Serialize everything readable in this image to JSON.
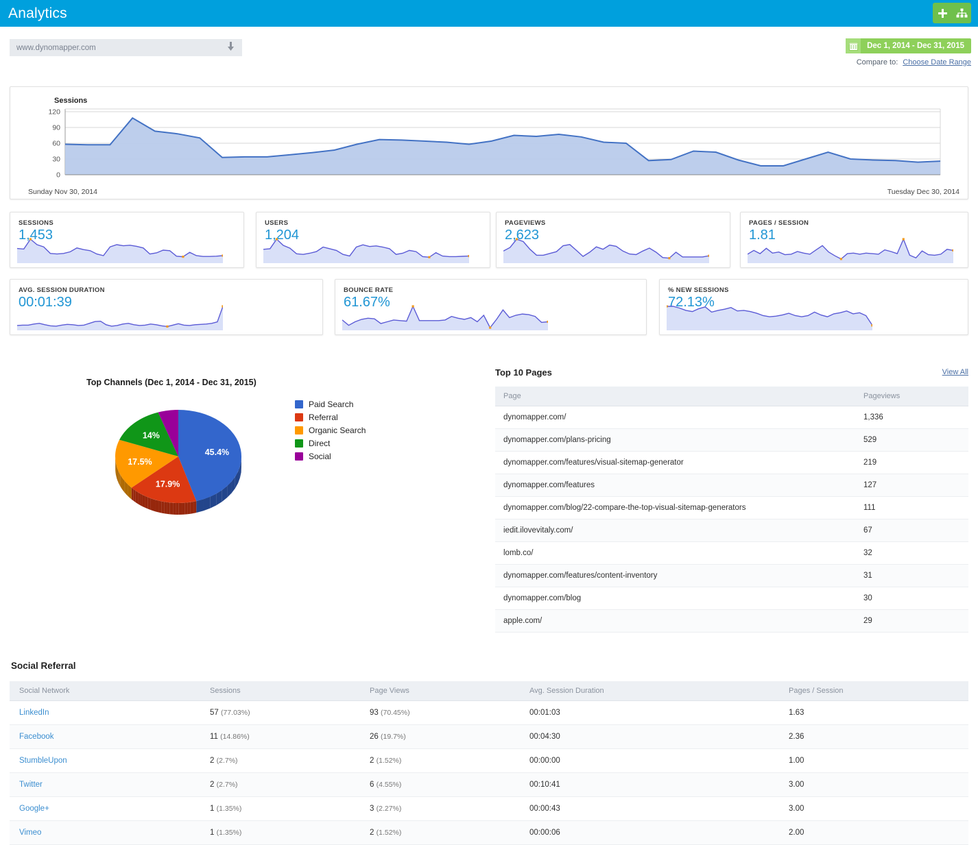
{
  "app": {
    "title": "Analytics",
    "brand_blue": "#00a0dd",
    "brand_green": "#6fc04c",
    "accent_blue": "#2196d4",
    "add_icon": "plus-icon",
    "sitemap_icon": "sitemap-icon"
  },
  "filters": {
    "site_value": "www.dynomapper.com",
    "site_caret_icon": "arrow-down-icon",
    "calendar_icon": "calendar-icon",
    "date_range": "Dec 1, 2014 - Dec 31, 2015",
    "compare_label": "Compare to:",
    "compare_link": "Choose Date Range"
  },
  "sessions_chart": {
    "title": "Sessions",
    "start_date": "Sunday Nov 30, 2014",
    "end_date": "Tuesday Dec 30, 2014"
  },
  "kpis": [
    {
      "label": "SESSIONS",
      "value": "1,453"
    },
    {
      "label": "USERS",
      "value": "1,204"
    },
    {
      "label": "PAGEVIEWS",
      "value": "2,623"
    },
    {
      "label": "PAGES / SESSION",
      "value": "1.81"
    },
    {
      "label": "AVG. SESSION DURATION",
      "value": "00:01:39"
    },
    {
      "label": "BOUNCE RATE",
      "value": "61.67%"
    },
    {
      "label": "% NEW SESSIONS",
      "value": "72.13%"
    }
  ],
  "pie": {
    "title": "Top Channels (Dec 1, 2014 - Dec 31, 2015)"
  },
  "top_pages": {
    "title": "Top 10 Pages",
    "view_all": "View All",
    "columns": [
      "Page",
      "Pageviews"
    ],
    "rows": [
      {
        "page": "dynomapper.com/",
        "pageviews": "1,336"
      },
      {
        "page": "dynomapper.com/plans-pricing",
        "pageviews": "529"
      },
      {
        "page": "dynomapper.com/features/visual-sitemap-generator",
        "pageviews": "219"
      },
      {
        "page": "dynomapper.com/features",
        "pageviews": "127"
      },
      {
        "page": "dynomapper.com/blog/22-compare-the-top-visual-sitemap-generators",
        "pageviews": "111"
      },
      {
        "page": "iedit.ilovevitaly.com/",
        "pageviews": "67"
      },
      {
        "page": "lomb.co/",
        "pageviews": "32"
      },
      {
        "page": "dynomapper.com/features/content-inventory",
        "pageviews": "31"
      },
      {
        "page": "dynomapper.com/blog",
        "pageviews": "30"
      },
      {
        "page": "apple.com/",
        "pageviews": "29"
      }
    ]
  },
  "social_referral": {
    "title": "Social Referral",
    "columns": [
      "Social Network",
      "Sessions",
      "Page Views",
      "Avg. Session Duration",
      "Pages / Session"
    ],
    "rows": [
      {
        "network": "LinkedIn",
        "sessions": "57",
        "sessions_pct": "(77.03%)",
        "pageviews": "93",
        "pageviews_pct": "(70.45%)",
        "duration": "00:01:03",
        "pages_session": "1.63"
      },
      {
        "network": "Facebook",
        "sessions": "11",
        "sessions_pct": "(14.86%)",
        "pageviews": "26",
        "pageviews_pct": "(19.7%)",
        "duration": "00:04:30",
        "pages_session": "2.36"
      },
      {
        "network": "StumbleUpon",
        "sessions": "2",
        "sessions_pct": "(2.7%)",
        "pageviews": "2",
        "pageviews_pct": "(1.52%)",
        "duration": "00:00:00",
        "pages_session": "1.00"
      },
      {
        "network": "Twitter",
        "sessions": "2",
        "sessions_pct": "(2.7%)",
        "pageviews": "6",
        "pageviews_pct": "(4.55%)",
        "duration": "00:10:41",
        "pages_session": "3.00"
      },
      {
        "network": "Google+",
        "sessions": "1",
        "sessions_pct": "(1.35%)",
        "pageviews": "3",
        "pageviews_pct": "(2.27%)",
        "duration": "00:00:43",
        "pages_session": "3.00"
      },
      {
        "network": "Vimeo",
        "sessions": "1",
        "sessions_pct": "(1.35%)",
        "pageviews": "2",
        "pageviews_pct": "(1.52%)",
        "duration": "00:00:06",
        "pages_session": "2.00"
      }
    ]
  },
  "chart_data": [
    {
      "type": "area",
      "name": "sessions-main",
      "title": "Sessions",
      "xlabel": "",
      "ylabel": "",
      "ylim": [
        0,
        120
      ],
      "yticks": [
        0,
        30,
        60,
        90,
        120
      ],
      "grid": true,
      "legend": "none",
      "x_start_label": "Sunday Nov 30, 2014",
      "x_end_label": "Tuesday Dec 30, 2014",
      "line_color": "#4372c4",
      "fill_color": "#b9cbeb",
      "values": [
        58,
        57,
        57,
        108,
        83,
        78,
        70,
        33,
        34,
        34,
        38,
        42,
        47,
        58,
        67,
        66,
        64,
        62,
        58,
        64,
        75,
        73,
        77,
        72,
        62,
        60,
        27,
        29,
        45,
        43,
        28,
        17,
        17,
        30,
        43,
        30,
        28,
        27,
        24,
        26
      ]
    },
    {
      "type": "area",
      "name": "sparkline-sessions",
      "title": "SESSIONS",
      "value": "1,453",
      "line_color": "#5b5bd6",
      "fill_color": "#ccd6f5",
      "marker_color": "#f29c1f",
      "values": [
        46,
        44,
        80,
        60,
        52,
        28,
        26,
        28,
        34,
        48,
        42,
        38,
        26,
        20,
        52,
        60,
        56,
        58,
        54,
        48,
        26,
        30,
        40,
        38,
        18,
        16,
        32,
        20,
        17,
        17,
        18,
        20
      ]
    },
    {
      "type": "area",
      "name": "sparkline-users",
      "title": "USERS",
      "value": "1,204",
      "line_color": "#5b5bd6",
      "fill_color": "#ccd6f5",
      "marker_color": "#f29c1f",
      "values": [
        42,
        44,
        78,
        56,
        46,
        26,
        24,
        28,
        34,
        50,
        44,
        38,
        24,
        18,
        50,
        58,
        52,
        54,
        50,
        44,
        24,
        28,
        38,
        34,
        16,
        14,
        30,
        18,
        16,
        16,
        17,
        18
      ]
    },
    {
      "type": "area",
      "name": "sparkline-pageviews",
      "title": "PAGEVIEWS",
      "value": "2,623",
      "line_color": "#5b5bd6",
      "fill_color": "#ccd6f5",
      "marker_color": "#f29c1f",
      "values": [
        34,
        46,
        74,
        66,
        40,
        20,
        20,
        26,
        32,
        52,
        56,
        36,
        16,
        30,
        48,
        40,
        54,
        50,
        34,
        24,
        22,
        34,
        44,
        30,
        12,
        10,
        30,
        14,
        14,
        14,
        14,
        18
      ]
    },
    {
      "type": "area",
      "name": "sparkline-pages-session",
      "title": "PAGES / SESSION",
      "value": "1.81",
      "line_color": "#5b5bd6",
      "fill_color": "#ccd6f5",
      "marker_color": "#f29c1f",
      "values": [
        26,
        40,
        28,
        48,
        30,
        34,
        24,
        26,
        36,
        30,
        26,
        42,
        58,
        34,
        20,
        8,
        28,
        30,
        26,
        30,
        28,
        26,
        42,
        36,
        28,
        82,
        22,
        12,
        38,
        24,
        22,
        26,
        44,
        40
      ]
    },
    {
      "type": "area",
      "name": "sparkline-avg-session-duration",
      "title": "AVG. SESSION DURATION",
      "value": "00:01:39",
      "line_color": "#5b5bd6",
      "fill_color": "#ccd6f5",
      "marker_color": "#f29c1f",
      "values": [
        8,
        9,
        9,
        12,
        14,
        10,
        7,
        6,
        9,
        11,
        10,
        8,
        9,
        14,
        19,
        20,
        10,
        6,
        8,
        12,
        14,
        10,
        8,
        9,
        12,
        10,
        7,
        5,
        9,
        13,
        9,
        8,
        10,
        11,
        12,
        14,
        18,
        62
      ]
    },
    {
      "type": "area",
      "name": "sparkline-bounce-rate",
      "title": "BOUNCE RATE",
      "value": "61.67%",
      "line_color": "#5b5bd6",
      "fill_color": "#ccd6f5",
      "marker_color": "#f29c1f",
      "values": [
        28,
        10,
        22,
        30,
        34,
        32,
        16,
        22,
        28,
        26,
        24,
        74,
        26,
        26,
        26,
        26,
        28,
        40,
        34,
        30,
        36,
        22,
        44,
        2,
        30,
        62,
        36,
        44,
        48,
        46,
        40,
        20,
        22
      ]
    },
    {
      "type": "area",
      "name": "sparkline-new-sessions",
      "title": "% NEW SESSIONS",
      "value": "72.13%",
      "line_color": "#5b5bd6",
      "fill_color": "#ccd6f5",
      "marker_color": "#f29c1f",
      "values": [
        76,
        76,
        70,
        62,
        58,
        68,
        74,
        56,
        62,
        66,
        72,
        60,
        62,
        58,
        52,
        44,
        40,
        42,
        46,
        52,
        44,
        40,
        44,
        56,
        46,
        40,
        50,
        54,
        60,
        50,
        54,
        44,
        10
      ]
    },
    {
      "type": "pie",
      "name": "top-channels",
      "title": "Top Channels (Dec 1, 2014 - Dec 31, 2015)",
      "three_d": true,
      "legend": "right",
      "labels": [
        "Paid Search",
        "Referral",
        "Organic Search",
        "Direct",
        "Social"
      ],
      "values": [
        45.4,
        17.9,
        17.5,
        14.0,
        5.2
      ],
      "value_labels": [
        "45.4%",
        "17.9%",
        "17.5%",
        "14%",
        ""
      ],
      "colors": [
        "#3366cc",
        "#dc3912",
        "#ff9900",
        "#109618",
        "#990099"
      ]
    }
  ]
}
